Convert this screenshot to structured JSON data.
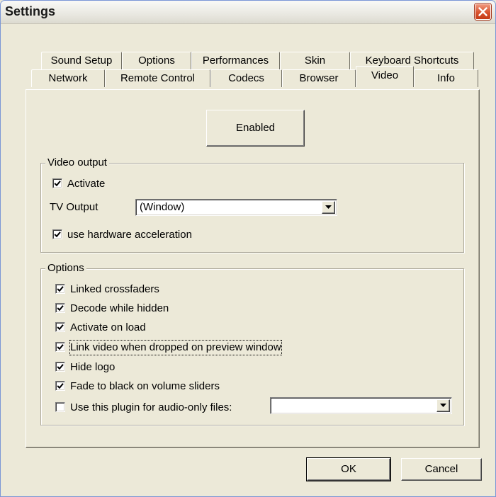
{
  "window": {
    "title": "Settings"
  },
  "tabs": {
    "row1": [
      "Sound Setup",
      "Options",
      "Performances",
      "Skin",
      "Keyboard Shortcuts"
    ],
    "row2": [
      "Network",
      "Remote Control",
      "Codecs",
      "Browser",
      "Video",
      "Info"
    ],
    "active": "Video"
  },
  "video": {
    "enabled_button": "Enabled",
    "output_group": {
      "label": "Video output",
      "activate": {
        "label": "Activate",
        "checked": true
      },
      "tv_output_label": "TV Output",
      "tv_output_value": "(Window)",
      "hw_accel": {
        "label": "use hardware acceleration",
        "checked": true
      }
    },
    "options_group": {
      "label": "Options",
      "items": [
        {
          "label": "Linked crossfaders",
          "checked": true
        },
        {
          "label": "Decode while hidden",
          "checked": true
        },
        {
          "label": "Activate on load",
          "checked": true
        },
        {
          "label": "Link video when dropped on preview window",
          "checked": true
        },
        {
          "label": "Hide logo",
          "checked": true
        },
        {
          "label": "Fade to black on volume sliders",
          "checked": true
        },
        {
          "label": "Use this plugin for audio-only files:",
          "checked": false
        }
      ],
      "audio_plugin_value": ""
    }
  },
  "footer": {
    "ok": "OK",
    "cancel": "Cancel"
  },
  "icons": {
    "close": "close-icon",
    "check": "checkmark-icon",
    "dropdown": "chevron-down-icon"
  }
}
